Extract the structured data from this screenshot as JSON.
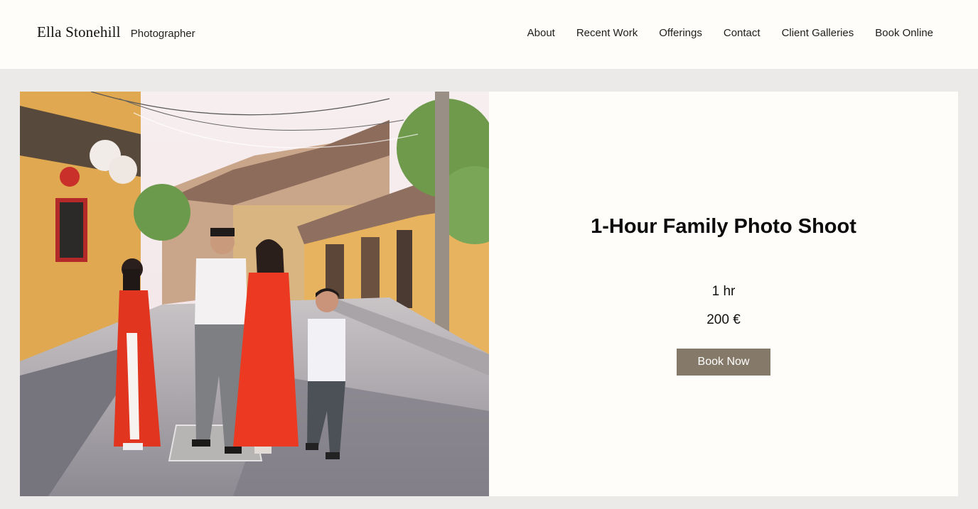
{
  "header": {
    "brand_name": "Ella Stonehill",
    "brand_tagline": "Photographer",
    "nav": [
      {
        "label": "About"
      },
      {
        "label": "Recent Work"
      },
      {
        "label": "Offerings"
      },
      {
        "label": "Contact"
      },
      {
        "label": "Client Galleries"
      },
      {
        "label": "Book Online"
      }
    ]
  },
  "service": {
    "title": "1-Hour Family Photo Shoot",
    "duration": "1 hr",
    "price": "200 €",
    "book_label": "Book Now"
  },
  "colors": {
    "header_bg": "#fefdf9",
    "page_bg": "#ebeae8",
    "button_bg": "#857a69"
  }
}
